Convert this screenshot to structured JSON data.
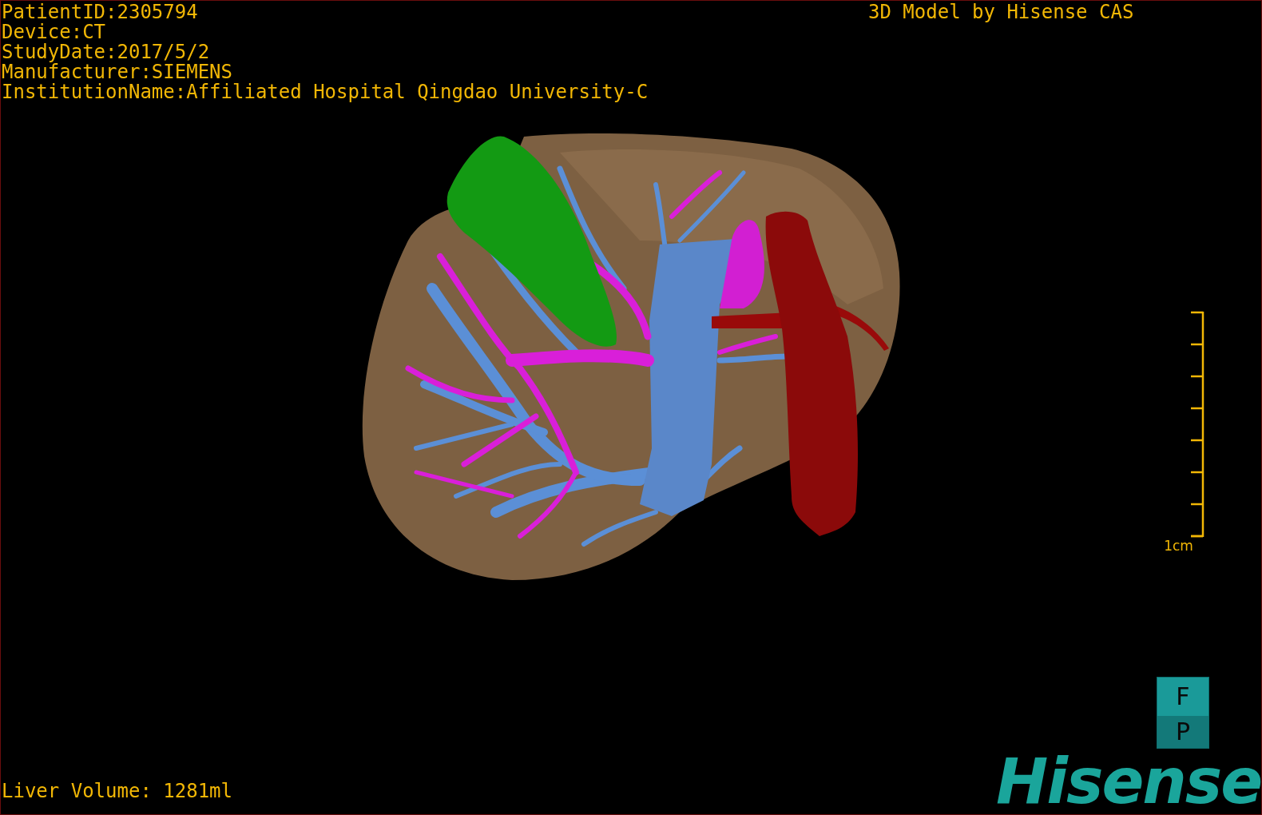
{
  "study_info": [
    "PatientID:2305794",
    "Device:CT",
    "StudyDate:2017/5/2",
    "Manufacturer:SIEMENS",
    "InstitutionName:Affiliated Hospital Qingdao University-C"
  ],
  "model_title": "3D Model by Hisense CAS",
  "scale_bar": {
    "label": "1cm"
  },
  "orientation_cube": {
    "top": "F",
    "bottom": "P"
  },
  "logo": "Hisense",
  "liver_volume": "Liver Volume: 1281ml"
}
